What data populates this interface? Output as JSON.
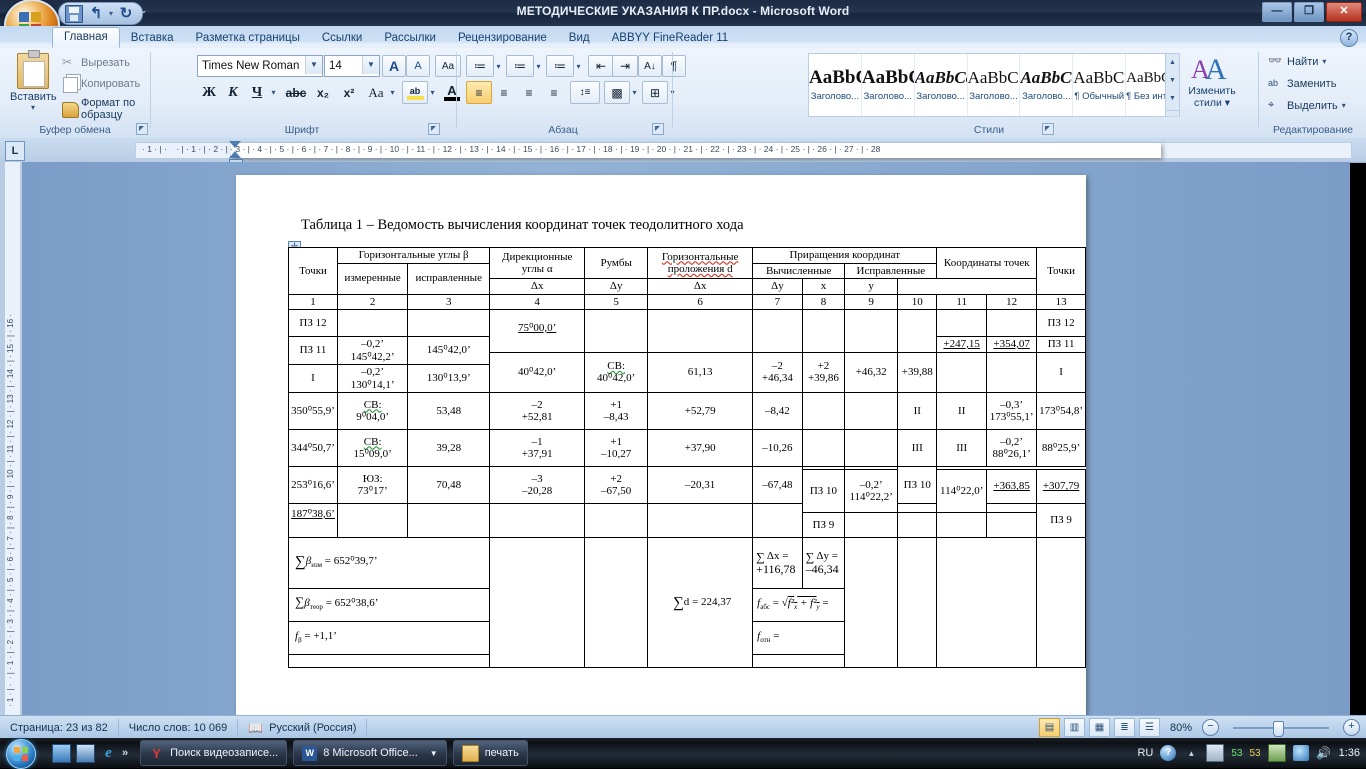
{
  "window": {
    "title": "МЕТОДИЧЕСКИЕ УКАЗАНИЯ К ПР.docx - Microsoft Word",
    "minimize": "—",
    "maximize": "❐",
    "close": "✕",
    "help": "?"
  },
  "quick_access": {
    "save": "save-icon",
    "undo": "↰",
    "redo": "↻",
    "more": "⌄"
  },
  "ribbon": {
    "tabs": [
      {
        "label": "Главная",
        "active": true
      },
      {
        "label": "Вставка",
        "active": false
      },
      {
        "label": "Разметка страницы",
        "active": false
      },
      {
        "label": "Ссылки",
        "active": false
      },
      {
        "label": "Рассылки",
        "active": false
      },
      {
        "label": "Рецензирование",
        "active": false
      },
      {
        "label": "Вид",
        "active": false
      },
      {
        "label": "ABBYY FineReader 11",
        "active": false
      }
    ],
    "groups": [
      {
        "name": "Буфер обмена"
      },
      {
        "name": "Шрифт"
      },
      {
        "name": "Абзац"
      },
      {
        "name": "Стили"
      },
      {
        "name": "Редактирование"
      }
    ],
    "clipboard": {
      "paste": "Вставить",
      "cut": "Вырезать",
      "copy": "Копировать",
      "format_painter": "Формат по образцу"
    },
    "font": {
      "family": "Times New Roman",
      "size": "14",
      "grow": "A",
      "shrink": "A",
      "clear_format": "Aa",
      "bold": "Ж",
      "italic": "К",
      "underline": "Ч",
      "strike": "abc",
      "subscript": "x₂",
      "superscript": "x²",
      "change_case": "Aa",
      "highlight": "ab",
      "fontcolor": "A"
    },
    "paragraph": {
      "bullets": "≔",
      "numbering": "≔",
      "multilevel": "≔",
      "decrease_indent": "⇤",
      "increase_indent": "⇥",
      "sort": "A↓",
      "show_marks": "¶",
      "align_left": "≡",
      "align_center": "≡",
      "align_right": "≡",
      "justify": "≡",
      "line_spacing": "↕≡",
      "shading": "▩",
      "borders": "⊞"
    },
    "styles": [
      {
        "sample": "AaBbC",
        "name": "Заголово..."
      },
      {
        "sample": "AaBbC",
        "name": "Заголово..."
      },
      {
        "sample": "AaBbCc",
        "name": "Заголово..."
      },
      {
        "sample": "AaBbCcI",
        "name": "Заголово..."
      },
      {
        "sample": "AaBbCcI",
        "name": "Заголово..."
      },
      {
        "sample": "AaBbCcI",
        "name": "¶ Обычный"
      },
      {
        "sample": "AaBbCcDc",
        "name": "¶ Без инте..."
      }
    ],
    "change_styles": "Изменить\nстили",
    "change_styles_l1": "Изменить",
    "change_styles_l2": "стили ▾",
    "editing": {
      "find": "Найти",
      "replace": "Заменить",
      "select": "Выделить"
    }
  },
  "ruler": {
    "tab_selector": "L",
    "h_labels": [
      "1",
      "1",
      "1",
      "2",
      "3",
      "4",
      "5",
      "6",
      "7",
      "8",
      "9",
      "10",
      "11",
      "12",
      "13",
      "14",
      "15",
      "16",
      "17",
      "18",
      "19",
      "20",
      "21",
      "22",
      "23",
      "24",
      "25",
      "26",
      "27",
      "28"
    ],
    "v_labels": [
      "1",
      "1",
      "2",
      "3",
      "4",
      "5",
      "6",
      "7",
      "8",
      "9",
      "10",
      "11",
      "12",
      "13",
      "14",
      "15",
      "16"
    ]
  },
  "document": {
    "caption": "Таблица 1 – Ведомость вычисления координат точек теодолитного хода",
    "table": {
      "headers": {
        "points": "Точки",
        "horizontal_angles": "Горизонтальные углы β",
        "measured": "измеренные",
        "corrected": "исправленные",
        "directional_angles": "Дирекционные углы α",
        "rhumbs": "Румбы",
        "horizontal_layouts": "Горизонтальные проложения d",
        "increments": "Приращения координат",
        "computed": "Вычисленные",
        "adjusted": "Исправленные",
        "coordinates": "Координаты точек",
        "dx": "Δx",
        "dy": "Δy",
        "x": "x",
        "y": "y",
        "points_right": "Точки"
      },
      "numbering": [
        "1",
        "2",
        "3",
        "4",
        "5",
        "6",
        "7",
        "8",
        "9",
        "10",
        "11",
        "12",
        "13"
      ],
      "rows": [
        {
          "point": "ПЗ 12",
          "measured_corr": "",
          "measured_val": "",
          "corrected": "",
          "dir_angle": "75⁰00,0’",
          "dir_underline": true,
          "rhumb_dir": "",
          "rhumb_val": "",
          "d": "",
          "dx_c_corr": "",
          "dx_c_val": "",
          "dy_c_corr": "",
          "dy_c_val": "",
          "dx_a": "",
          "dy_a": "",
          "x": "",
          "y": "",
          "point_right": "ПЗ 12"
        },
        {
          "point": "ПЗ 11",
          "measured_corr": "–0,2’",
          "measured_val": "145⁰42,2’",
          "corrected": "145⁰42,0’",
          "dir_angle": "40⁰42,0’",
          "dir_underline": false,
          "rhumb_dir": "СВ:",
          "rhumb_val": "40⁰42,0’",
          "d": "61,13",
          "dx_c_corr": "–2",
          "dx_c_val": "+46,34",
          "dy_c_corr": "+2",
          "dy_c_val": "+39,86",
          "dx_a": "+46,32",
          "dy_a": "+39,88",
          "x": "+247,15",
          "y": "+354,07",
          "point_right": "ПЗ 11"
        },
        {
          "point": "I",
          "measured_corr": "–0,2’",
          "measured_val": "130⁰14,1’",
          "corrected": "130⁰13,9’",
          "dir_angle": "350⁰55,9’",
          "dir_underline": false,
          "rhumb_dir": "СВ:",
          "rhumb_val": "9⁰04,0’",
          "d": "53,48",
          "dx_c_corr": "–2",
          "dx_c_val": "+52,81",
          "dy_c_corr": "+1",
          "dy_c_val": "–8,43",
          "dx_a": "+52,79",
          "dy_a": "–8,42",
          "x": "",
          "y": "",
          "point_right": "I"
        },
        {
          "point": "II",
          "measured_corr": "–0,3’",
          "measured_val": "173⁰55,1’",
          "corrected": "173⁰54,8’",
          "dir_angle": "344⁰50,7’",
          "dir_underline": false,
          "rhumb_dir": "СВ:",
          "rhumb_val": "15⁰09,0’",
          "d": "39,28",
          "dx_c_corr": "–1",
          "dx_c_val": "+37,91",
          "dy_c_corr": "+1",
          "dy_c_val": "–10,27",
          "dx_a": "+37,90",
          "dy_a": "–10,26",
          "x": "",
          "y": "",
          "point_right": "II"
        },
        {
          "point": "III",
          "measured_corr": "–0,2’",
          "measured_val": "88⁰26,1’",
          "corrected": "88⁰25,9’",
          "dir_angle": "253⁰16,6’",
          "dir_underline": false,
          "rhumb_dir": "ЮЗ:",
          "rhumb_val": "73⁰17’",
          "d": "70,48",
          "dx_c_corr": "–3",
          "dx_c_val": "–20,28",
          "dy_c_corr": "+2",
          "dy_c_val": "–67,50",
          "dx_a": "–20,31",
          "dy_a": "–67,48",
          "x": "",
          "y": "",
          "point_right": "III"
        },
        {
          "point": "ПЗ 10",
          "measured_corr": "–0,2’",
          "measured_val": "114⁰22,2’",
          "corrected": "114⁰22,0’",
          "dir_angle": "187⁰38,6’",
          "dir_underline": true,
          "rhumb_dir": "",
          "rhumb_val": "",
          "d": "",
          "dx_c_corr": "",
          "dx_c_val": "",
          "dy_c_corr": "",
          "dy_c_val": "",
          "dx_a": "",
          "dy_a": "",
          "x": "+363,85",
          "y": "+307,79",
          "point_right": "ПЗ 10"
        },
        {
          "point": "ПЗ 9",
          "measured_corr": "",
          "measured_val": "",
          "corrected": "",
          "dir_angle": "",
          "dir_underline": false,
          "rhumb_dir": "",
          "rhumb_val": "",
          "d": "",
          "dx_c_corr": "",
          "dx_c_val": "",
          "dy_c_corr": "",
          "dy_c_val": "",
          "dx_a": "",
          "dy_a": "",
          "x": "",
          "y": "",
          "point_right": "ПЗ 9"
        }
      ],
      "summary": {
        "sum_beta_meas_sym": "β",
        "sum_beta_meas_sub": "изм",
        "sum_beta_meas_val": "= 652⁰39,7’",
        "sum_beta_theor_sym": "β",
        "sum_beta_theor_sub": "теор",
        "sum_beta_theor_val": "= 652⁰38,6’",
        "f_beta": "f",
        "f_beta_sub": "β",
        "f_beta_val": " = +1,1’",
        "sum_d": "d =  224,37",
        "sum_dx_label": "Δx =",
        "sum_dx_val": "+116,78",
        "sum_dy_label": "Δy =",
        "sum_dy_val": "–46,34",
        "f_abs_label": "f",
        "f_abs_sub": "абс",
        "f_abs_formula": "= √(f²ₓ + f²ᵧ) =",
        "f_rel_label": "f",
        "f_rel_sub": "отн",
        "f_rel_eq": " ="
      }
    }
  },
  "status_bar": {
    "page": "Страница: 23 из 82",
    "words": "Число слов: 10 069",
    "language": "Русский (Россия)",
    "spell_icon": "spellcheck-icon",
    "views": [
      "print-layout-icon",
      "fullscreen-reading-icon",
      "web-layout-icon",
      "outline-icon",
      "draft-icon"
    ],
    "zoom": "80%",
    "zoom_out": "−",
    "zoom_in": "+"
  },
  "taskbar": {
    "start": "start-orb",
    "quick_launch": [
      "show-desktop-icon",
      "switch-window-icon",
      "internet-explorer-icon"
    ],
    "overflow": "»",
    "items": [
      {
        "label": "Поиск видеозаписе...",
        "icon": "yandex-icon"
      },
      {
        "label": "8 Microsoft Office...",
        "icon": "word-icon",
        "has_arrow": true
      },
      {
        "label": "печать",
        "icon": "folder-icon"
      }
    ],
    "tray": {
      "language": "RU",
      "help": "?",
      "counters": [
        "53",
        "53"
      ],
      "time": "1:36"
    }
  },
  "colors": {
    "accent": "#1f4e8c",
    "title_bg": "#1d2b44",
    "ribbon_bg": "#e7f0fa",
    "page_bg": "#ffffff"
  }
}
